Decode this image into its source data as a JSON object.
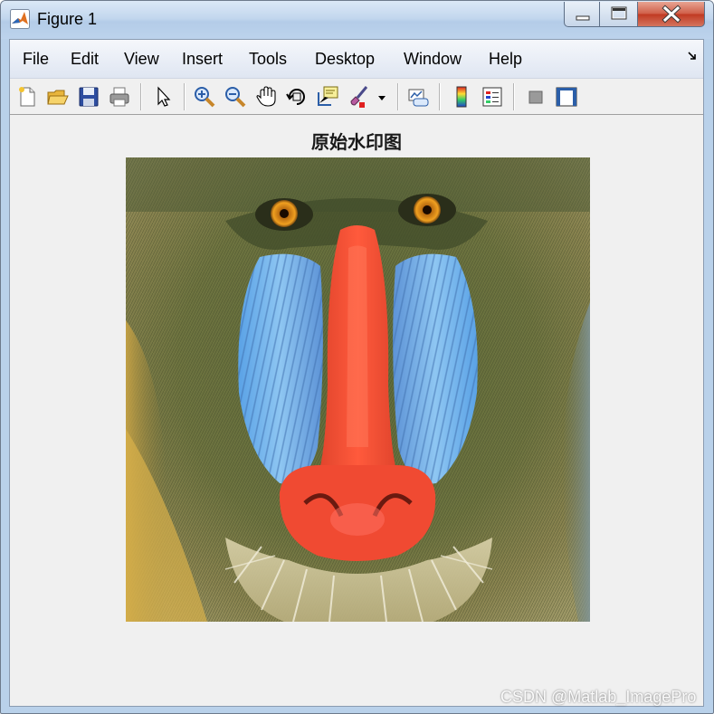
{
  "window": {
    "title": "Figure 1"
  },
  "menu": {
    "items": [
      "File",
      "Edit",
      "View",
      "Insert",
      "Tools",
      "Desktop",
      "Window",
      "Help"
    ]
  },
  "toolbar": {
    "tools": [
      "new-figure-icon",
      "open-file-icon",
      "save-icon",
      "print-icon",
      "edit-plot-pointer-icon",
      "zoom-in-icon",
      "zoom-out-icon",
      "pan-hand-icon",
      "rotate-3d-icon",
      "data-cursor-icon",
      "brush-icon",
      "brush-dropdown-icon",
      "link-plot-icon",
      "insert-colorbar-icon",
      "insert-legend-icon",
      "hide-plot-tools-icon",
      "show-plot-tools-icon"
    ]
  },
  "axes": {
    "title": "原始水印图",
    "image": "mandrill-face-image"
  },
  "watermark": {
    "text": "CSDN @Matlab_ImagePro"
  },
  "colors": {
    "titlebar": "#c3d7ee",
    "close_button": "#c13a22",
    "figure_background": "#f0f0f0"
  }
}
